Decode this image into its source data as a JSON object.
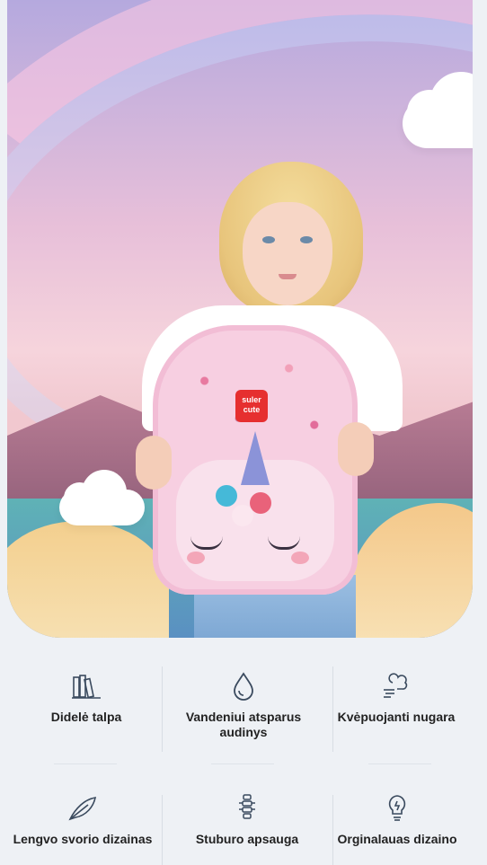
{
  "hero": {
    "brand_logo_text": [
      "suler",
      "cute"
    ]
  },
  "features": [
    {
      "icon": "books-icon",
      "label": "Didelė talpa"
    },
    {
      "icon": "water-drop-icon",
      "label": "Vandeniui atsparus audinys"
    },
    {
      "icon": "wind-icon",
      "label": "Kvėpuojanti nugara"
    },
    {
      "icon": "feather-icon",
      "label": "Lengvo svorio dizainas"
    },
    {
      "icon": "spine-icon",
      "label": "Stuburo apsauga"
    },
    {
      "icon": "lightbulb-icon",
      "label": "Orginalauas dizaino"
    }
  ]
}
